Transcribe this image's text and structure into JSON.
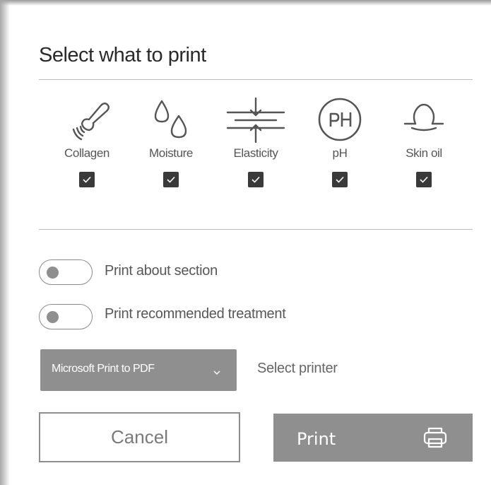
{
  "dialog": {
    "title": "Select what to print"
  },
  "metrics": [
    {
      "label": "Collagen",
      "icon": "collagen-probe-icon",
      "checked": true
    },
    {
      "label": "Moisture",
      "icon": "droplets-icon",
      "checked": true
    },
    {
      "label": "Elasticity",
      "icon": "elasticity-arrows-icon",
      "checked": true
    },
    {
      "label": "pH",
      "icon": "ph-circle-icon",
      "checked": true
    },
    {
      "label": "Skin oil",
      "icon": "oil-drop-icon",
      "checked": true
    }
  ],
  "options": {
    "about": {
      "label": "Print about section",
      "enabled": false
    },
    "treatment": {
      "label": "Print recommended treatment",
      "enabled": false
    }
  },
  "printer": {
    "selected": "Microsoft Print to PDF",
    "caption": "Select printer"
  },
  "buttons": {
    "cancel": "Cancel",
    "print": "Print"
  },
  "colors": {
    "accent_gray": "#8f8f8f",
    "checkbox": "#3a3a3a",
    "divider": "#bdbdbd"
  }
}
